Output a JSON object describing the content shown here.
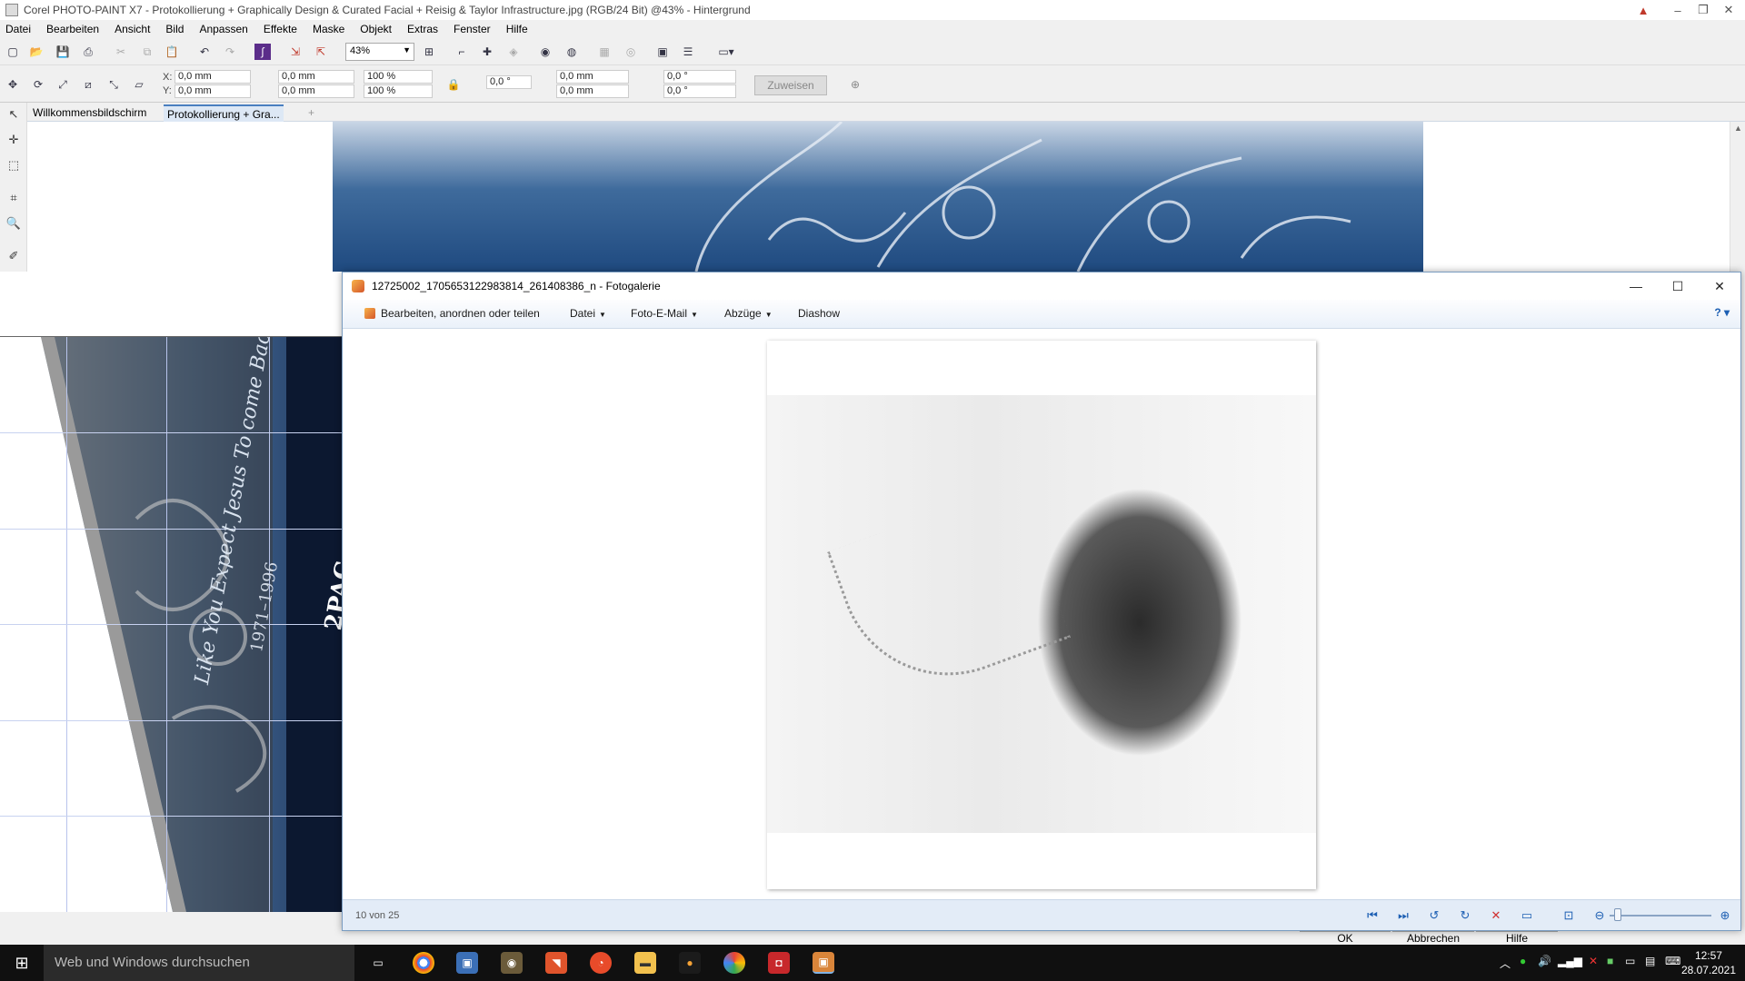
{
  "app": {
    "title": "Corel PHOTO-PAINT X7 - Protokollierung + Graphically Design & Curated Facial + Reisig & Taylor Infrastructure.jpg (RGB/24 Bit) @43% - Hintergrund"
  },
  "menu": [
    "Datei",
    "Bearbeiten",
    "Ansicht",
    "Bild",
    "Anpassen",
    "Effekte",
    "Maske",
    "Objekt",
    "Extras",
    "Fenster",
    "Hilfe"
  ],
  "toolbar": {
    "zoom": "43%"
  },
  "props": {
    "x_label": "X:",
    "y_label": "Y:",
    "x": "0,0 mm",
    "y": "0,0 mm",
    "w": "0,0 mm",
    "h": "0,0 mm",
    "sx": "100 %",
    "sy": "100 %",
    "angle": "0,0 °",
    "cx": "0,0 mm",
    "cy": "0,0 mm",
    "skew_h": "0,0 °",
    "skew_v": "0,0 °",
    "assign": "Zuweisen"
  },
  "tabs": [
    "Willkommensbildschirm",
    "Protokollierung + Gra..."
  ],
  "canvas_text": {
    "script": "Like You Expect Jesus To come Back",
    "years": "1971–1996",
    "name": "2PAC"
  },
  "dialog_buttons": [
    "OK",
    "Abbrechen",
    "Hilfe"
  ],
  "gallery": {
    "title": "12725002_1705653122983814_261408386_n - Fotogalerie",
    "cmd": {
      "edit": "Bearbeiten, anordnen oder teilen",
      "file": "Datei",
      "email": "Foto-E-Mail",
      "prints": "Abzüge",
      "slideshow": "Diashow"
    },
    "counter": "10 von 25",
    "zoom_level": 0.05
  },
  "taskbar": {
    "search_placeholder": "Web und Windows durchsuchen",
    "time": "12:57",
    "date": "28.07.2021"
  }
}
